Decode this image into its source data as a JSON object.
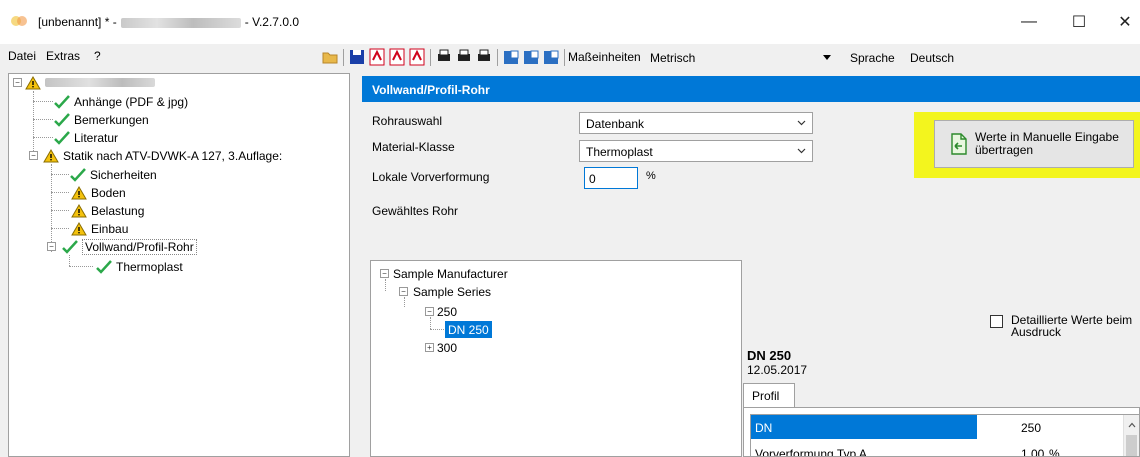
{
  "window": {
    "title_prefix": "[unbenannt] * -",
    "title_version": "- V.2.7.0.0",
    "minimize": "—",
    "maximize": "☐",
    "close": "✕"
  },
  "menu": {
    "items": [
      "Datei",
      "Extras",
      "?"
    ]
  },
  "toolbar": {
    "units_label": "Maßeinheiten",
    "units_value": "Metrisch",
    "language_label": "Sprache",
    "language_value": "Deutsch"
  },
  "tree": {
    "items": [
      "Anhänge (PDF & jpg)",
      "Bemerkungen",
      "Literatur",
      "Statik nach ATV-DVWK-A 127, 3.Auflage:",
      "Sicherheiten",
      "Boden",
      "Belastung",
      "Einbau",
      "Vollwand/Profil-Rohr",
      "Thermoplast"
    ]
  },
  "main": {
    "header": "Vollwand/Profil-Rohr",
    "rohrauswahl_label": "Rohrauswahl",
    "rohrauswahl_value": "Datenbank",
    "material_label": "Material-Klasse",
    "material_value": "Thermoplast",
    "vorverformung_label": "Lokale Vorverformung",
    "vorverformung_value": "0",
    "vorverformung_unit": "%",
    "gewaehlt_label": "Gewähltes Rohr",
    "transfer_button_line1": "Werte in Manuelle Eingabe",
    "transfer_button_line2": "übertragen"
  },
  "pipe_tree": {
    "manufacturer": "Sample Manufacturer",
    "series": "Sample Series",
    "node_250": "250",
    "node_dn250": "DN 250",
    "node_300": "300"
  },
  "details": {
    "checkbox_line1": "Detaillierte Werte beim",
    "checkbox_line2": "Ausdruck",
    "dn_title": "DN 250",
    "dn_date": "12.05.2017",
    "tab_label": "Profil",
    "rows": [
      {
        "name": "DN",
        "value": "250",
        "unit": ""
      },
      {
        "name": "Vorverformung Typ A",
        "value": "1.00",
        "unit": "%"
      }
    ]
  }
}
